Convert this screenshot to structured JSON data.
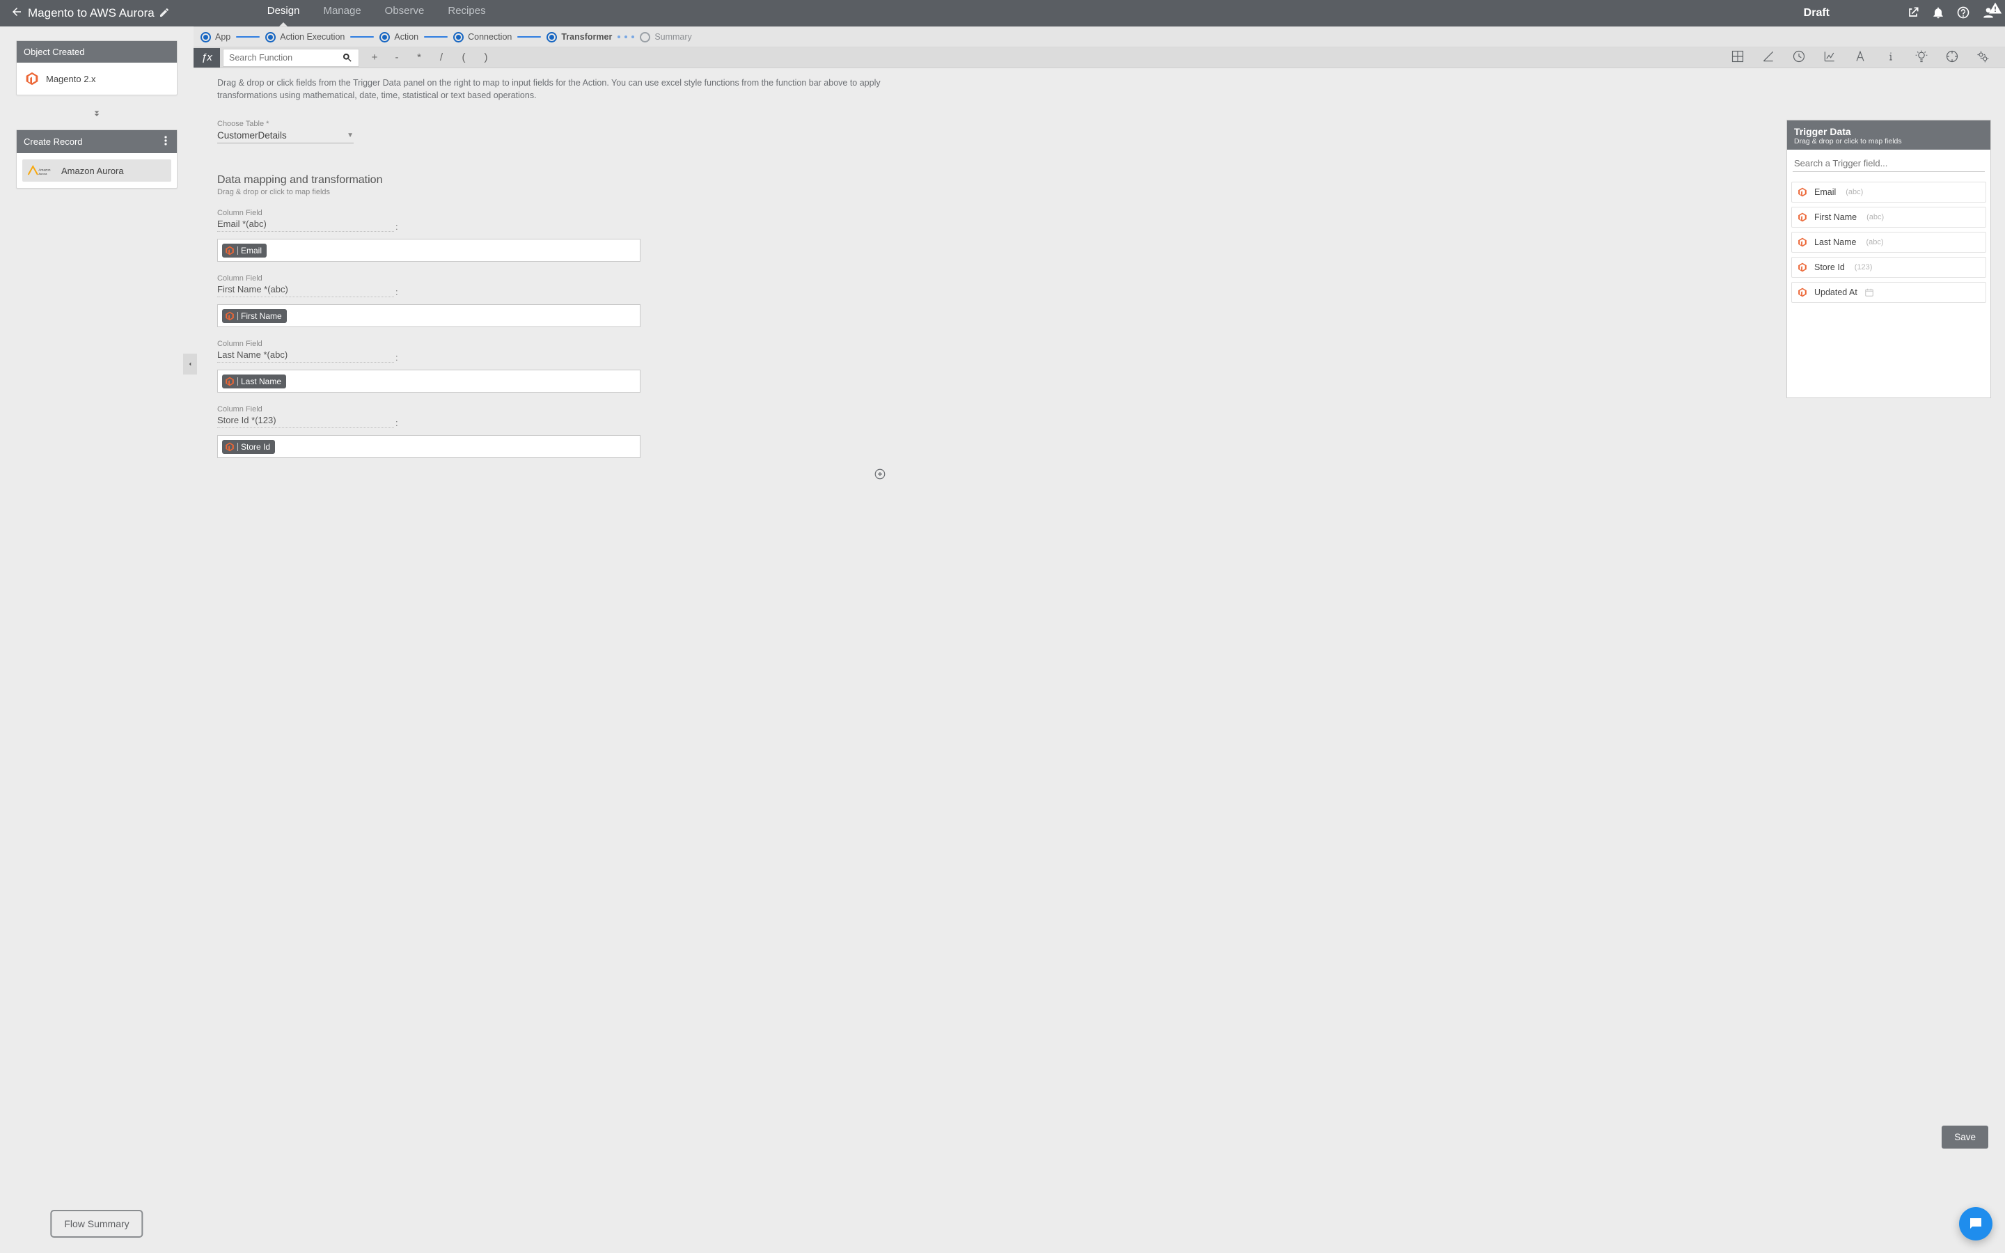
{
  "header": {
    "title": "Magento to AWS Aurora",
    "status": "Draft",
    "tabs": {
      "design": "Design",
      "manage": "Manage",
      "observe": "Observe",
      "recipes": "Recipes"
    }
  },
  "left_panel": {
    "card1": {
      "title": "Object Created",
      "app": "Magento 2.x"
    },
    "card2": {
      "title": "Create Record",
      "app": "Amazon Aurora"
    },
    "flow_summary": "Flow Summary"
  },
  "steps": {
    "app": "App",
    "action_exec": "Action Execution",
    "action": "Action",
    "connection": "Connection",
    "transformer": "Transformer",
    "summary": "Summary"
  },
  "formula": {
    "search_placeholder": "Search Function",
    "ops": {
      "plus": "+",
      "minus": "-",
      "mult": "*",
      "div": "/",
      "lp": "(",
      "rp": ")"
    }
  },
  "helper": "Drag & drop or click fields from the Trigger Data panel on the right to map to input fields for the Action. You can use excel style functions from the function bar above to apply transformations using mathematical, date, time, statistical or text based operations.",
  "choose_table": {
    "label": "Choose Table *",
    "value": "CustomerDetails"
  },
  "mapping": {
    "title": "Data mapping and transformation",
    "subtitle": "Drag & drop or click to map fields",
    "column_label": "Column Field",
    "fields": [
      {
        "name": "Email *(abc)",
        "chip": "Email"
      },
      {
        "name": "First Name *(abc)",
        "chip": "First Name"
      },
      {
        "name": "Last Name *(abc)",
        "chip": "Last Name"
      },
      {
        "name": "Store Id *(123)",
        "chip": "Store Id"
      }
    ]
  },
  "trigger": {
    "title": "Trigger Data",
    "subtitle": "Drag & drop or click to map fields",
    "search_placeholder": "Search a Trigger field...",
    "items": [
      {
        "name": "Email",
        "type": "(abc)"
      },
      {
        "name": "First Name",
        "type": "(abc)"
      },
      {
        "name": "Last Name",
        "type": "(abc)"
      },
      {
        "name": "Store Id",
        "type": "(123)"
      },
      {
        "name": "Updated At",
        "type": "",
        "icon": "calendar"
      }
    ]
  },
  "save_label": "Save"
}
